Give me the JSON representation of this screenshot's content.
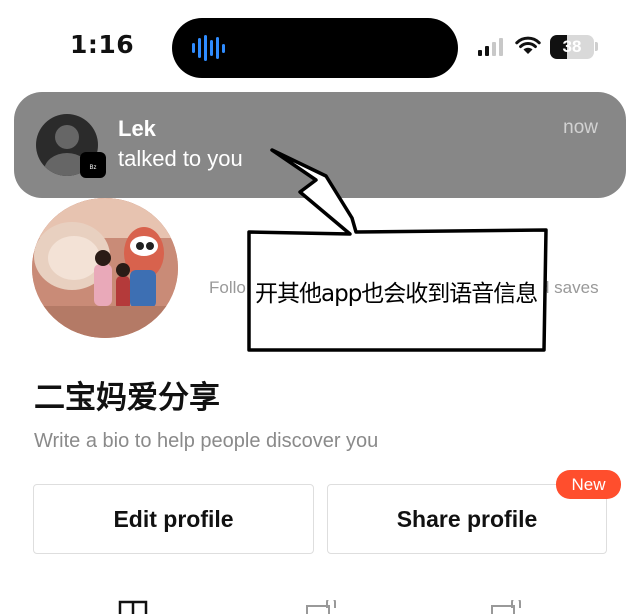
{
  "status_bar": {
    "time": "1:16",
    "battery": "38",
    "battery_level": 0.38,
    "signal_bars_filled": 2,
    "accent": "#2f8cff"
  },
  "notification": {
    "sender": "Lek",
    "message": "talked to you",
    "time": "now",
    "avatar_icon": "default-user-avatar",
    "app_badge": "Bz"
  },
  "profile": {
    "follow_stat_partial": "Follo",
    "saves_stat_partial": "d saves",
    "name": "二宝妈爱分享",
    "bio_placeholder": "Write a bio to help people discover you",
    "edit_button": "Edit profile",
    "share_button": "Share profile",
    "new_badge": "New",
    "badge_color": "#ff4e2d"
  },
  "annotation": {
    "text": "开其他app也会收到语音信息"
  },
  "bottom_tabs": {
    "icons": [
      "grid-icon",
      "bag-icon",
      "bag-icon"
    ]
  }
}
